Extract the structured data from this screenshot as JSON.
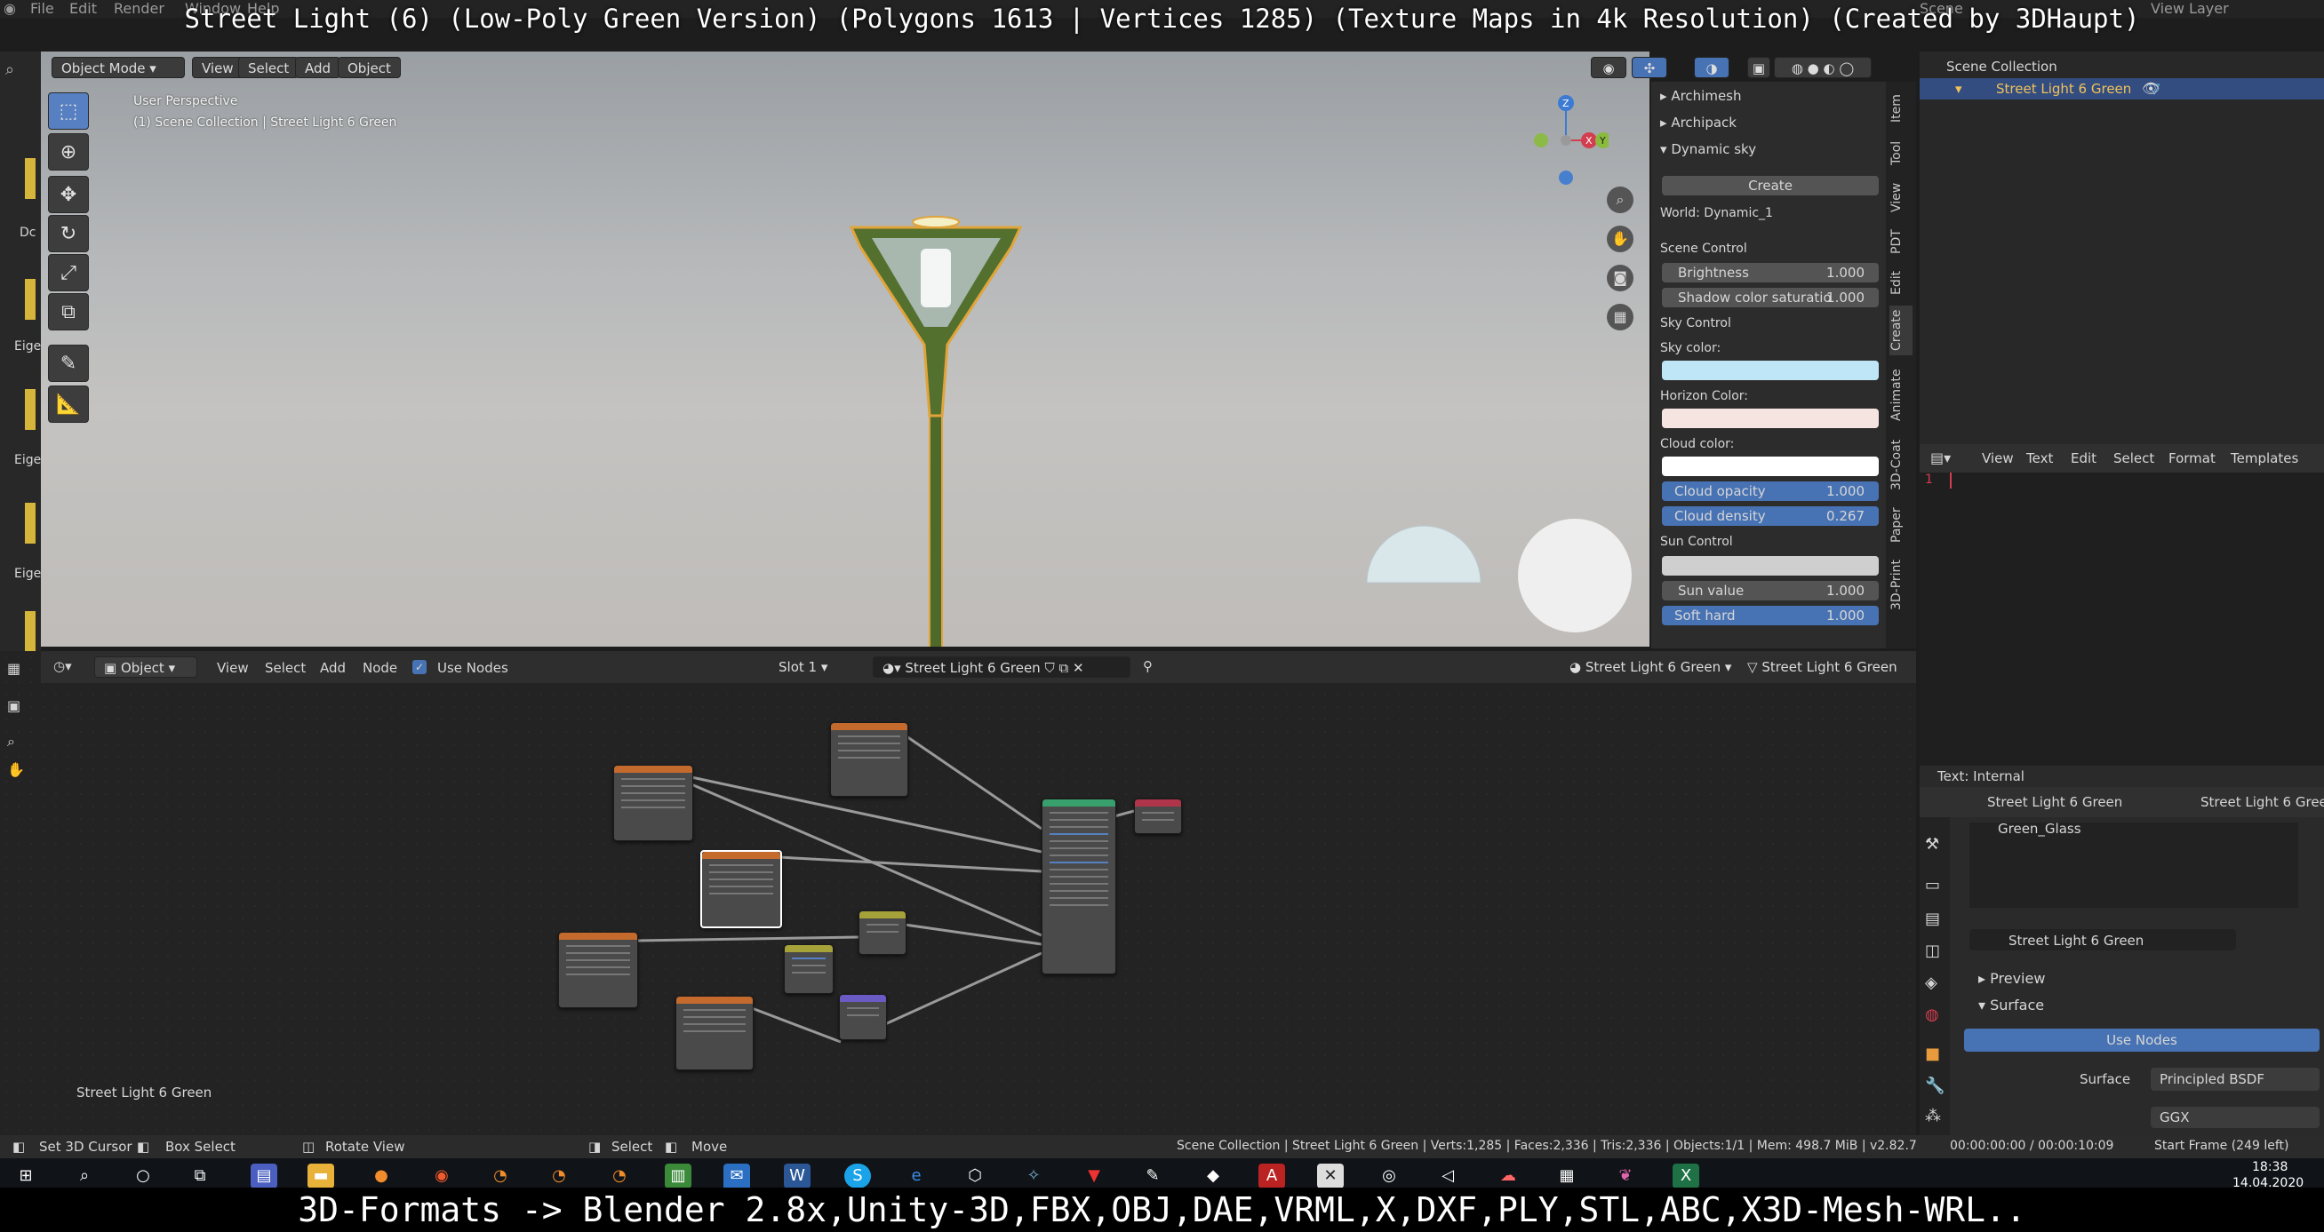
{
  "overlay": {
    "title": "Street Light (6) (Low-Poly Green Version) (Polygons 1613 | Vertices 1285) (Texture Maps in 4k Resolution) (Created by 3DHaupt)",
    "bottom": "3D-Formats -> Blender 2.8x,Unity-3D,FBX,OBJ,DAE,VRML,X,DXF,PLY,STL,ABC,X3D-Mesh-WRL.."
  },
  "menu": {
    "file": "File",
    "edit": "Edit",
    "render": "Render",
    "window": "Window",
    "help": "Help",
    "view_layer": "View Layer",
    "scene": "Scene"
  },
  "viewport": {
    "mode": "Object Mode",
    "menus": [
      "View",
      "Select",
      "Add",
      "Object"
    ],
    "perspective": "User Perspective",
    "collection_path": "(1) Scene Collection | Street Light 6 Green",
    "gizmo": {
      "z": "Z",
      "x": "X",
      "y": "Y"
    }
  },
  "left_labels": [
    "Dc",
    "Eige",
    "Eige",
    "Eige"
  ],
  "npanel": {
    "sections": [
      "Archimesh",
      "Archipack",
      "Dynamic sky"
    ],
    "create_button": "Create",
    "world": "World: Dynamic_1",
    "scene_control": "Scene Control",
    "brightness": {
      "label": "Brightness",
      "value": "1.000"
    },
    "shadow": {
      "label": "Shadow color saturatio",
      "value": "1.000"
    },
    "sky_control": "Sky Control",
    "sky_color": "Sky color:",
    "horizon_color": "Horizon Color:",
    "cloud_color": "Cloud color:",
    "cloud_opacity": {
      "label": "Cloud opacity",
      "value": "1.000"
    },
    "cloud_density": {
      "label": "Cloud density",
      "value": "0.267"
    },
    "sun_control": "Sun Control",
    "sun_value": {
      "label": "Sun value",
      "value": "1.000"
    },
    "soft_hard": {
      "label": "Soft hard",
      "value": "1.000"
    },
    "colors": {
      "sky": "#bfe6f7",
      "horizon": "#f6e4e1",
      "cloud": "#ffffff"
    }
  },
  "vtabs": [
    "Item",
    "Tool",
    "View",
    "PDT",
    "Edit",
    "Create",
    "Animate",
    "3D-Coat",
    "Paper",
    "3D-Print"
  ],
  "outliner": {
    "root": "Scene Collection",
    "item": "Street Light 6 Green"
  },
  "texteditor": {
    "menus": [
      "View",
      "Text",
      "Edit",
      "Select",
      "Format",
      "Templates"
    ],
    "line": "1",
    "footer": "Text: Internal"
  },
  "node_editor": {
    "type": "Object",
    "menus": [
      "View",
      "Select",
      "Add",
      "Node"
    ],
    "use_nodes": "Use Nodes",
    "slot": "Slot 1",
    "material": "Street Light 6 Green",
    "object": "Street Light 6 Green",
    "object2": "Street Light 6 Green",
    "footer": "Street Light 6 Green"
  },
  "properties": {
    "object": "Street Light 6 Green",
    "material_tab": "Street Light 6 Green",
    "slot": "Green_Glass",
    "material": "Street Light 6 Green",
    "preview": "Preview",
    "surface_section": "Surface",
    "use_nodes": "Use Nodes",
    "surface_label": "Surface",
    "surface_value": "Principled BSDF",
    "distribution": "GGX"
  },
  "statusbar": {
    "cursor": "Set 3D Cursor",
    "box": "Box Select",
    "rotate": "Rotate View",
    "select": "Select",
    "move": "Move",
    "info": "Scene Collection | Street Light 6 Green | Verts:1,285 | Faces:2,336 | Tris:2,336 | Objects:1/1 | Mem: 498.7 MiB | v2.82.7",
    "time": "00:00:00:00 / 00:00:10:09",
    "frame": "Start Frame (249 left)"
  },
  "taskbar": {
    "time": "18:38",
    "date": "14.04.2020"
  }
}
